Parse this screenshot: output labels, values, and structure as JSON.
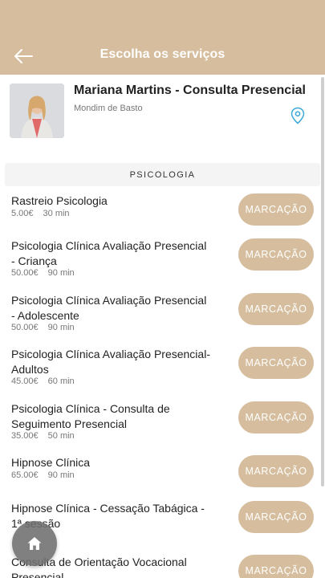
{
  "header": {
    "title": "Escolha os serviços",
    "back_icon": "arrow-left-icon",
    "background_color": "#d5bd9d"
  },
  "profile": {
    "name": "Mariana Martins - Consulta Presencial",
    "location": "Mondim de Basto",
    "location_icon": "map-pin-icon"
  },
  "section": {
    "title": "PSICOLOGIA"
  },
  "services": [
    {
      "name": "Rastreio Psicologia",
      "price": "5.00€",
      "duration": "30 min",
      "button": "MARCAÇÃO"
    },
    {
      "name": "Psicologia Clínica Avaliação Presencial - Criança",
      "price": "50.00€",
      "duration": "90 min",
      "button": "MARCAÇÃO"
    },
    {
      "name": "Psicologia Clínica Avaliação Presencial - Adolescente",
      "price": "50.00€",
      "duration": "90 min",
      "button": "MARCAÇÃO"
    },
    {
      "name": "Psicologia Clínica Avaliação Presencial- Adultos",
      "price": "45.00€",
      "duration": "60 min",
      "button": "MARCAÇÃO"
    },
    {
      "name": "Psicologia Clínica - Consulta de Seguimento Presencial",
      "price": "35.00€",
      "duration": "50 min",
      "button": "MARCAÇÃO"
    },
    {
      "name": "Hipnose Clínica",
      "price": "65.00€",
      "duration": "90 min",
      "button": "MARCAÇÃO"
    },
    {
      "name": "Hipnose Clínica - Cessação Tabágica - 1ª sessão",
      "price": "",
      "duration": "",
      "button": "MARCAÇÃO"
    },
    {
      "name": "Consulta de Orientação Vocacional Presencial",
      "price": "",
      "duration": "",
      "button": "MARCAÇÃO"
    }
  ],
  "fab": {
    "icon": "home-icon"
  },
  "colors": {
    "accent": "#d5bd9d",
    "pin": "#3aa8d8"
  }
}
